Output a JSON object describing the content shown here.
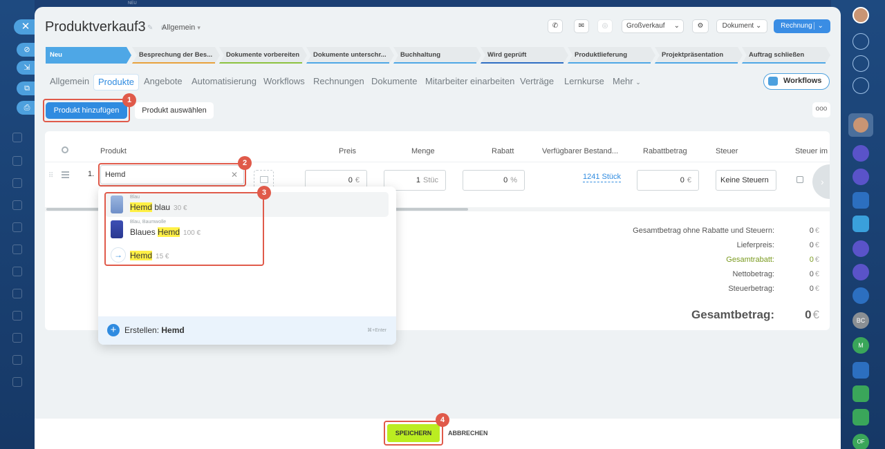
{
  "header": {
    "title": "Produktverkauf3",
    "category": "Allgemein",
    "pipeline": "Großverkauf",
    "document_label": "Dokument",
    "invoice_label": "Rechnung"
  },
  "stages": [
    {
      "label": "Neu",
      "color": "#4ea7e6"
    },
    {
      "label": "Besprechung der Bes...",
      "color": "#e8a23c"
    },
    {
      "label": "Dokumente vorbereiten",
      "color": "#8cc23f"
    },
    {
      "label": "Dokumente unterschr...",
      "color": "#4ea7e6"
    },
    {
      "label": "Buchhaltung",
      "color": "#4ea7e6"
    },
    {
      "label": "Wird geprüft",
      "color": "#2f6fc4"
    },
    {
      "label": "Produktlieferung",
      "color": "#4ea7e6"
    },
    {
      "label": "Projektpräsentation",
      "color": "#4ea7e6"
    },
    {
      "label": "Auftrag schließen",
      "color": "#4ea7e6"
    }
  ],
  "tabs": [
    "Allgemein",
    "Produkte",
    "Angebote",
    "Automatisierung",
    "Workflows",
    "Rechnungen",
    "Dokumente",
    "Mitarbeiter einarbeiten",
    "Verträge",
    "Lernkurse",
    "Mehr"
  ],
  "workflows_button": "Workflows",
  "actions": {
    "add_product": "Produkt hinzufügen",
    "select_product": "Produkt auswählen",
    "more": "ooo"
  },
  "table": {
    "headers": [
      "Produkt",
      "Preis",
      "Menge",
      "Rabatt",
      "Verfügbarer Bestand...",
      "Rabattbetrag",
      "Steuer",
      "Steuer im I"
    ],
    "row": {
      "index": "1.",
      "product_value": "Hemd",
      "price": "0",
      "price_unit": "€",
      "quantity": "1",
      "quantity_unit": "Stüc",
      "discount": "0",
      "discount_unit": "%",
      "stock": "1241 Stück",
      "discount_amount": "0",
      "discount_amount_unit": "€",
      "tax": "Keine Steuern"
    }
  },
  "dropdown": {
    "items": [
      {
        "sub": "Blau",
        "match": "Hemd",
        "rest": " blau",
        "price": "30 €"
      },
      {
        "sub": "Blau, Baumwolle",
        "pre": "Blaues ",
        "match": "Hemd",
        "price": "100 €"
      },
      {
        "match": "Hemd",
        "price": "15 €"
      }
    ],
    "create_label": "Erstellen:",
    "create_value": "Hemd",
    "shortcut": "⌘+Enter"
  },
  "summary": {
    "rows": [
      {
        "label": "Gesamtbetrag ohne Rabatte und Steuern:",
        "value": "0"
      },
      {
        "label": "Lieferpreis:",
        "value": "0"
      },
      {
        "label": "Gesamtrabatt:",
        "value": "0"
      },
      {
        "label": "Nettobetrag:",
        "value": "0"
      },
      {
        "label": "Steuerbetrag:",
        "value": "0"
      }
    ],
    "currency": "€",
    "total_label": "Gesamtbetrag:",
    "total_value": "0"
  },
  "footer": {
    "save": "SPEICHERN",
    "cancel": "ABBRECHEN"
  },
  "badges": [
    "1",
    "2",
    "3",
    "4"
  ],
  "left_rail": {
    "top_label": "NEU"
  },
  "right_rail": {
    "avatars": [
      "BC",
      "M",
      "OF"
    ]
  },
  "colors": {
    "accent": "#2f8be0",
    "save_green": "#bbed21",
    "highlight_red": "#e05a4a",
    "match_yellow": "#fff046"
  }
}
